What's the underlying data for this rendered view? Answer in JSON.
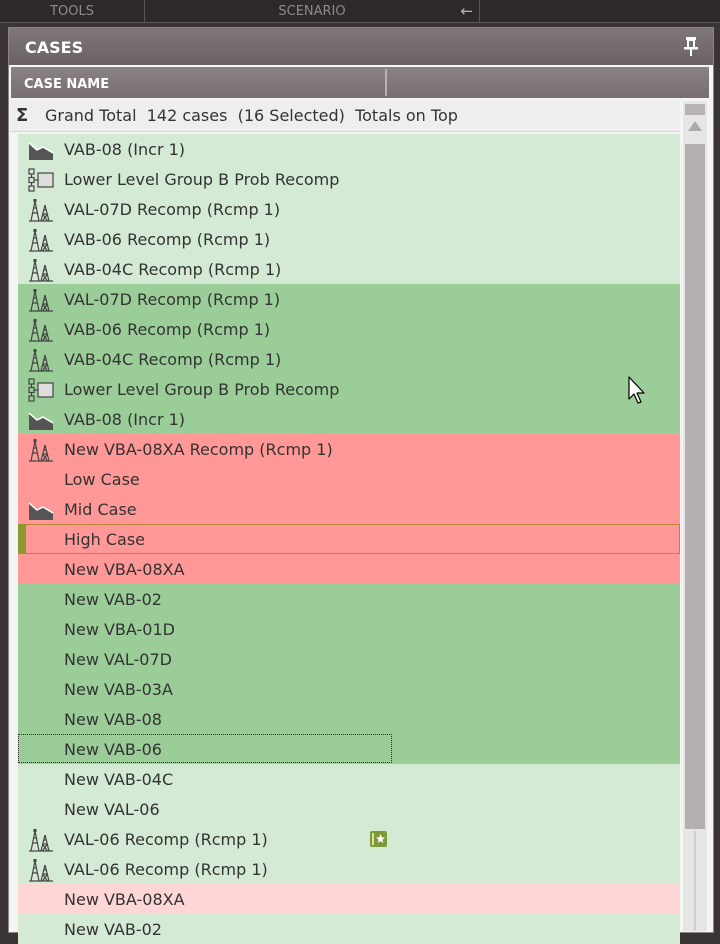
{
  "topbar": {
    "tools_label": "TOOLS",
    "scenario_label": "SCENARIO",
    "collapse_icon": "arrow-left-icon"
  },
  "panel": {
    "title": "CASES",
    "pin_icon": "pin-icon"
  },
  "table": {
    "columns": [
      "CASE NAME",
      ""
    ],
    "grand_total": "Grand Total  142 cases  (16 Selected)  Totals on Top",
    "rows": [
      {
        "label": "VAB-08 (Incr 1)",
        "icon": "decline-curve-icon",
        "color": "light-green"
      },
      {
        "label": "Lower Level Group B Prob Recomp",
        "icon": "group-tree-icon",
        "color": "light-green"
      },
      {
        "label": "VAL-07D Recomp (Rcmp 1)",
        "icon": "oil-rig-icon",
        "color": "light-green"
      },
      {
        "label": "VAB-06 Recomp (Rcmp 1)",
        "icon": "oil-rig-icon",
        "color": "light-green"
      },
      {
        "label": "VAB-04C Recomp (Rcmp 1)",
        "icon": "oil-rig-icon",
        "color": "light-green"
      },
      {
        "label": "VAL-07D Recomp (Rcmp 1)",
        "icon": "oil-rig-icon",
        "color": "green"
      },
      {
        "label": "VAB-06 Recomp (Rcmp 1)",
        "icon": "oil-rig-icon",
        "color": "green"
      },
      {
        "label": "VAB-04C Recomp (Rcmp 1)",
        "icon": "oil-rig-icon",
        "color": "green"
      },
      {
        "label": "Lower Level Group B Prob Recomp",
        "icon": "group-tree-icon",
        "color": "green"
      },
      {
        "label": "VAB-08 (Incr 1)",
        "icon": "decline-curve-icon",
        "color": "green"
      },
      {
        "label": "New VBA-08XA Recomp (Rcmp 1)",
        "icon": "oil-rig-icon",
        "color": "red"
      },
      {
        "label": "Low Case",
        "icon": "",
        "color": "red"
      },
      {
        "label": "Mid Case",
        "icon": "decline-curve-icon",
        "color": "red"
      },
      {
        "label": "High Case",
        "icon": "",
        "color": "red",
        "selected": true
      },
      {
        "label": "New VBA-08XA",
        "icon": "",
        "color": "red"
      },
      {
        "label": "New VAB-02",
        "icon": "",
        "color": "green"
      },
      {
        "label": "New VBA-01D",
        "icon": "",
        "color": "green"
      },
      {
        "label": "New VAL-07D",
        "icon": "",
        "color": "green"
      },
      {
        "label": "New VAB-03A",
        "icon": "",
        "color": "green"
      },
      {
        "label": "New VAB-08",
        "icon": "",
        "color": "green"
      },
      {
        "label": "New VAB-06",
        "icon": "",
        "color": "green",
        "focused": true
      },
      {
        "label": "New VAB-04C",
        "icon": "",
        "color": "light-green"
      },
      {
        "label": "New VAL-06",
        "icon": "",
        "color": "light-green"
      },
      {
        "label": "VAL-06 Recomp (Rcmp 1)",
        "icon": "oil-rig-icon",
        "color": "light-green",
        "note_icon": true
      },
      {
        "label": "VAL-06 Recomp (Rcmp 1)",
        "icon": "oil-rig-icon",
        "color": "light-green"
      },
      {
        "label": "New VBA-08XA",
        "icon": "",
        "color": "pink"
      },
      {
        "label": "New VAB-02",
        "icon": "",
        "color": "light-green"
      }
    ]
  },
  "colors": {
    "light_green": "#d4ead4",
    "green": "#9acd97",
    "red": "#ff9896",
    "pink": "#ffd6d6",
    "header": "#766e71",
    "selection_marker": "#8a9a2f"
  }
}
